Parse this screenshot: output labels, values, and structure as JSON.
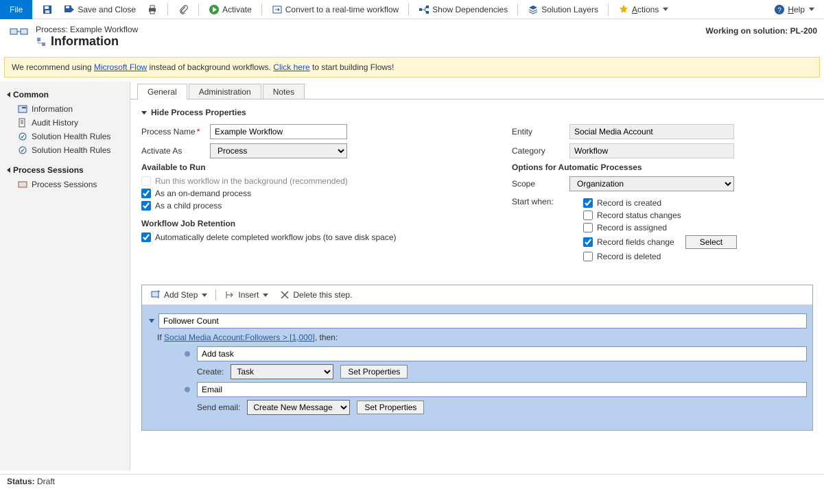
{
  "toolbar": {
    "file": "File",
    "saveClose": "Save and Close",
    "activate": "Activate",
    "convert": "Convert to a real-time workflow",
    "showDeps": "Show Dependencies",
    "solutionLayers": "Solution Layers",
    "actions": "Actions",
    "help": "Help"
  },
  "header": {
    "procType": "Process: Example Workflow",
    "pageTitle": "Information",
    "workingOnPrefix": "Working on solution:",
    "workingOnValue": "PL-200"
  },
  "banner": {
    "pre": "We recommend using ",
    "link1": "Microsoft Flow",
    "mid": " instead of background workflows. ",
    "link2": "Click here",
    "post": " to start building Flows!"
  },
  "nav": {
    "common": {
      "title": "Common",
      "items": [
        "Information",
        "Audit History",
        "Solution Health Rules",
        "Solution Health Rules"
      ]
    },
    "sessions": {
      "title": "Process Sessions",
      "items": [
        "Process Sessions"
      ]
    }
  },
  "tabs": {
    "general": "General",
    "admin": "Administration",
    "notes": "Notes"
  },
  "section": {
    "hideProps": "Hide Process Properties"
  },
  "left": {
    "processNameLabel": "Process Name",
    "processNameValue": "Example Workflow",
    "activateAsLabel": "Activate As",
    "activateAsValue": "Process",
    "availableToRun": "Available to Run",
    "bgCheckbox": "Run this workflow in the background (recommended)",
    "onDemand": "As an on-demand process",
    "childProc": "As a child process",
    "jobRetention": "Workflow Job Retention",
    "autoDelete": "Automatically delete completed workflow jobs (to save disk space)"
  },
  "right": {
    "entityLabel": "Entity",
    "entityValue": "Social Media Account",
    "categoryLabel": "Category",
    "categoryValue": "Workflow",
    "optionsHead": "Options for Automatic Processes",
    "scopeLabel": "Scope",
    "scopeValue": "Organization",
    "startWhen": "Start when:",
    "recCreated": "Record is created",
    "statusChanges": "Record status changes",
    "recAssigned": "Record is assigned",
    "fieldsChange": "Record fields change",
    "recDeleted": "Record is deleted",
    "selectBtn": "Select"
  },
  "designer": {
    "addStep": "Add Step",
    "insert": "Insert",
    "deleteStep": "Delete this step.",
    "stepName": "Follower Count",
    "ifPrefix": "If ",
    "conditionText": "Social Media Account:Followers > [1,000]",
    "thenSuffix": ", then:",
    "subAddTask": "Add task",
    "createLabel": "Create:",
    "createValue": "Task",
    "setProps": "Set Properties",
    "subEmail": "Email",
    "sendEmailLabel": "Send email:",
    "sendEmailValue": "Create New Message"
  },
  "status": {
    "label": "Status:",
    "value": "Draft"
  }
}
